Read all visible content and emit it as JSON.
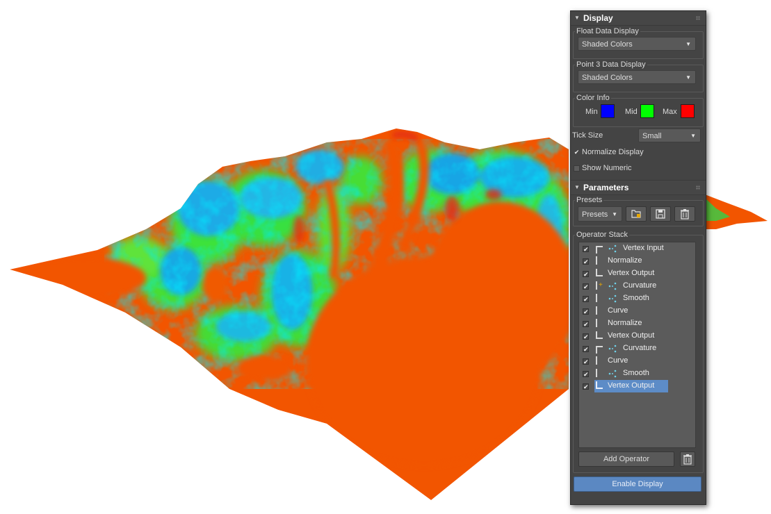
{
  "display": {
    "title": "Display",
    "float_data_display": {
      "label": "Float Data Display",
      "value": "Shaded Colors"
    },
    "point3_data_display": {
      "label": "Point 3 Data Display",
      "value": "Shaded Colors"
    },
    "color_info": {
      "label": "Color Info",
      "min": {
        "label": "Min",
        "color": "#0000ff"
      },
      "mid": {
        "label": "Mid",
        "color": "#00ff00"
      },
      "max": {
        "label": "Max",
        "color": "#ff0000"
      }
    },
    "tick_size": {
      "label": "Tick Size",
      "value": "Small"
    },
    "normalize_display": {
      "label": "Normalize Display",
      "checked": true
    },
    "show_numeric": {
      "label": "Show Numeric",
      "checked": false
    }
  },
  "parameters": {
    "title": "Parameters",
    "presets_group_label": "Presets",
    "presets_dropdown": "Presets",
    "operator_stack_label": "Operator Stack",
    "operators": [
      {
        "label": "Vertex Input",
        "checked": true
      },
      {
        "label": "Normalize",
        "checked": true
      },
      {
        "label": "Vertex Output",
        "checked": true
      },
      {
        "label": "Curvature",
        "checked": true
      },
      {
        "label": "Smooth",
        "checked": true
      },
      {
        "label": "Curve",
        "checked": true
      },
      {
        "label": "Normalize",
        "checked": true
      },
      {
        "label": "Vertex Output",
        "checked": true
      },
      {
        "label": "Curvature",
        "checked": true
      },
      {
        "label": "Curve",
        "checked": true
      },
      {
        "label": "Smooth",
        "checked": true
      },
      {
        "label": "Vertex Output",
        "checked": true,
        "selected": true
      }
    ],
    "add_operator_label": "Add Operator",
    "enable_display_label": "Enable Display"
  },
  "viewport": {
    "description_colors": {
      "terrain_base": "#f25500",
      "high_curvature": "#00d4ff",
      "mid": "#33ee33"
    }
  }
}
